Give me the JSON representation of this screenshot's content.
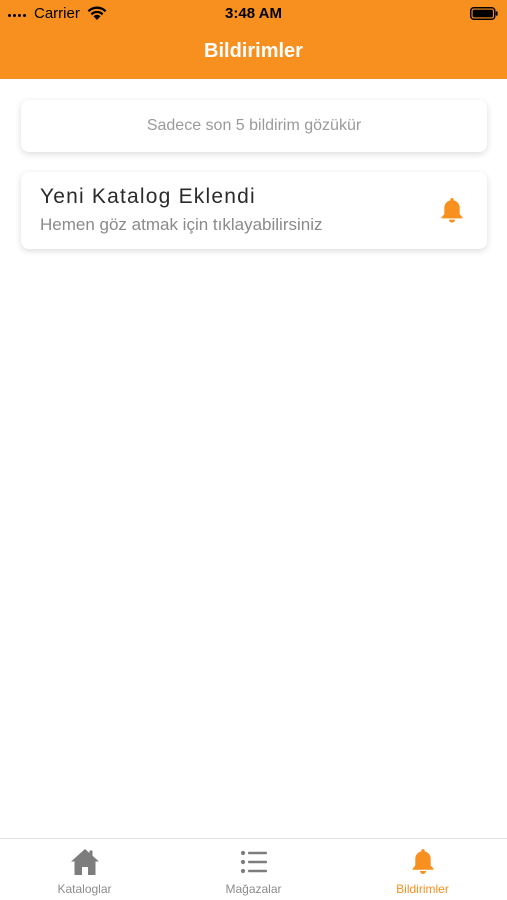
{
  "status_bar": {
    "carrier": "Carrier",
    "time": "3:48 AM"
  },
  "header": {
    "title": "Bildirimler"
  },
  "info_card": {
    "text": "Sadece son 5 bildirim gözükür"
  },
  "notifications": [
    {
      "title": "Yeni Katalog Eklendi",
      "subtitle": "Hemen göz atmak için tıklayabilirsiniz",
      "icon": "bell-icon"
    }
  ],
  "tabbar": {
    "tabs": [
      {
        "label": "Kataloglar",
        "icon": "home-icon",
        "active": false
      },
      {
        "label": "Mağazalar",
        "icon": "list-icon",
        "active": false
      },
      {
        "label": "Bildirimler",
        "icon": "bell-icon",
        "active": true
      }
    ]
  },
  "colors": {
    "accent": "#f7901e",
    "inactive": "#8c8c8c"
  }
}
